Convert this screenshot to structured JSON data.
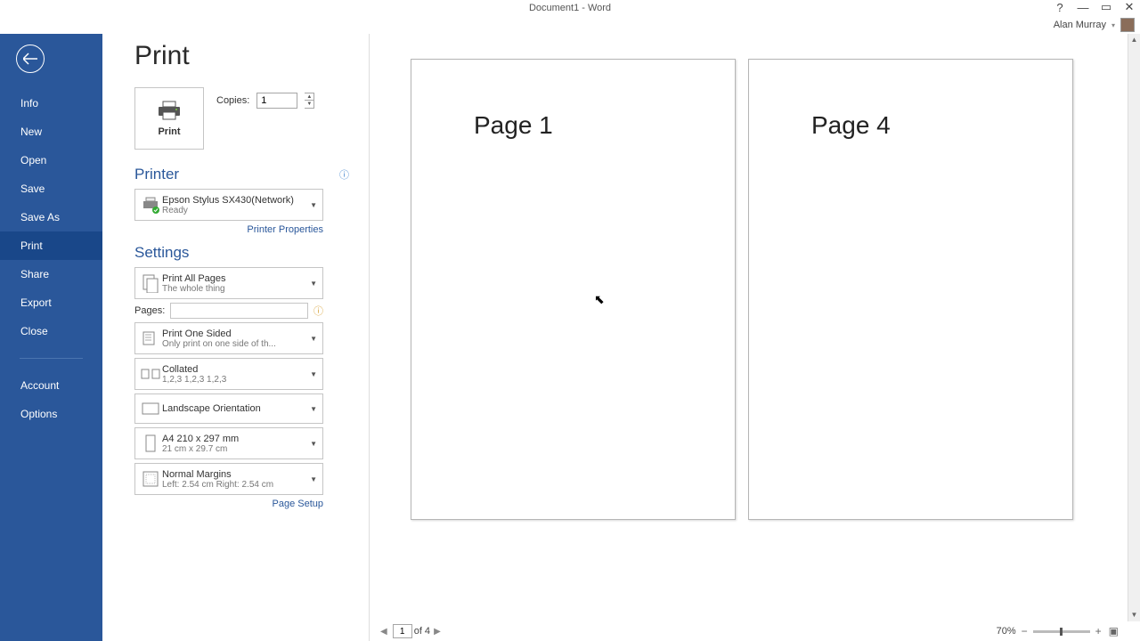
{
  "window": {
    "title": "Document1 - Word"
  },
  "user": {
    "name": "Alan Murray"
  },
  "sidebar": {
    "items": [
      "Info",
      "New",
      "Open",
      "Save",
      "Save As",
      "Print",
      "Share",
      "Export",
      "Close"
    ],
    "active": "Print",
    "bottom": [
      "Account",
      "Options"
    ]
  },
  "print": {
    "title": "Print",
    "button": "Print",
    "copies_label": "Copies:",
    "copies_value": "1"
  },
  "printer": {
    "heading": "Printer",
    "name": "Epson Stylus SX430(Network)",
    "status": "Ready",
    "properties_link": "Printer Properties"
  },
  "settings": {
    "heading": "Settings",
    "scope": {
      "title": "Print All Pages",
      "sub": "The whole thing"
    },
    "pages_label": "Pages:",
    "pages_value": "",
    "sides": {
      "title": "Print One Sided",
      "sub": "Only print on one side of th..."
    },
    "collate": {
      "title": "Collated",
      "sub": "1,2,3    1,2,3    1,2,3"
    },
    "orientation": {
      "title": "Landscape Orientation"
    },
    "paper": {
      "title": "A4 210 x 297 mm",
      "sub": "21 cm x 29.7 cm"
    },
    "margins": {
      "title": "Normal Margins",
      "sub": "Left:  2.54 cm    Right:  2.54 cm"
    },
    "page_setup_link": "Page Setup"
  },
  "preview": {
    "pages": [
      "Page 1",
      "Page 4"
    ]
  },
  "status": {
    "current_page": "1",
    "total_label": "of 4",
    "zoom": "70%"
  }
}
